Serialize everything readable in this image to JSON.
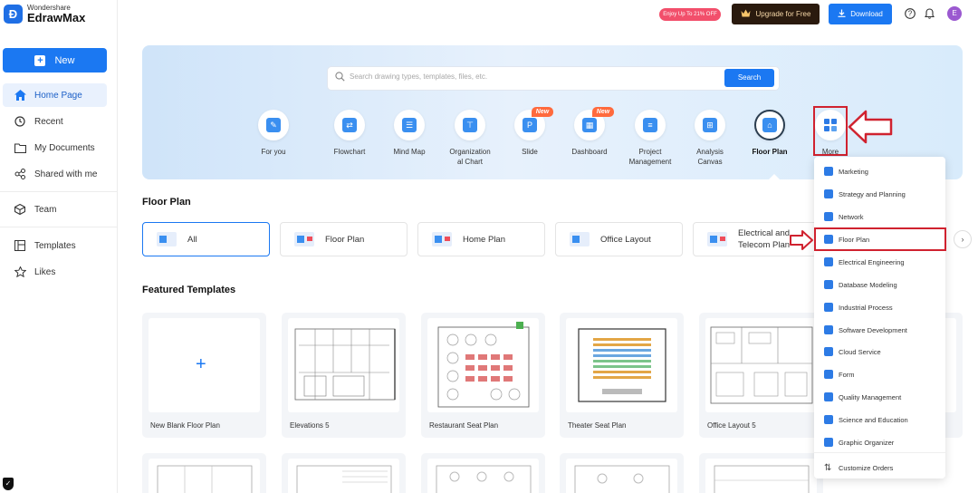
{
  "app": {
    "brand_small": "Wondershare",
    "brand_name": "EdrawMax"
  },
  "sidebar": {
    "new_label": "New",
    "items": [
      {
        "label": "Home Page",
        "icon": "home-icon",
        "active": true
      },
      {
        "label": "Recent",
        "icon": "clock-icon"
      },
      {
        "label": "My Documents",
        "icon": "folder-icon"
      },
      {
        "label": "Shared with me",
        "icon": "share-icon"
      },
      {
        "label": "Team",
        "icon": "team-icon"
      },
      {
        "label": "Templates",
        "icon": "templates-icon"
      },
      {
        "label": "Likes",
        "icon": "star-icon"
      }
    ]
  },
  "topbar": {
    "promo": "Enjoy Up To 21% OFF",
    "upgrade_label": "Upgrade for Free",
    "download_label": "Download",
    "avatar_letter": "E"
  },
  "hero": {
    "search_placeholder": "Search drawing types, templates, files, etc.",
    "search_button": "Search",
    "categories": [
      {
        "label": "For you",
        "icon": "for-you-icon"
      },
      {
        "label": "Flowchart",
        "icon": "flowchart-icon"
      },
      {
        "label": "Mind Map",
        "icon": "mind-map-icon"
      },
      {
        "label": "Organization\nal Chart",
        "icon": "org-chart-icon"
      },
      {
        "label": "Slide",
        "icon": "slide-icon",
        "badge": "New"
      },
      {
        "label": "Dashboard",
        "icon": "dashboard-icon",
        "badge": "New"
      },
      {
        "label": "Project\nManagement",
        "icon": "project-icon"
      },
      {
        "label": "Analysis\nCanvas",
        "icon": "analysis-icon"
      },
      {
        "label": "Floor Plan",
        "icon": "floor-plan-icon",
        "active": true
      },
      {
        "label": "More",
        "icon": "more-icon"
      }
    ]
  },
  "section": {
    "title": "Floor Plan",
    "filters": [
      "All",
      "Floor Plan",
      "Home Plan",
      "Office Layout",
      "Electrical and\nTelecom Plan"
    ]
  },
  "featured": {
    "title": "Featured Templates",
    "cards": [
      "New Blank Floor Plan",
      "Elevations 5",
      "Restaurant Seat Plan",
      "Theater Seat Plan",
      "Office Layout 5"
    ]
  },
  "more_menu": {
    "items": [
      "Marketing",
      "Strategy and Planning",
      "Network",
      "Floor Plan",
      "Electrical Engineering",
      "Database Modeling",
      "Industrial Process",
      "Software Development",
      "Cloud Service",
      "Form",
      "Quality Management",
      "Science and Education",
      "Graphic Organizer"
    ],
    "footer": "Customize Orders"
  },
  "colors": {
    "accent": "#1b78f2",
    "highlight": "#d0222f",
    "hero_bg": "#dbeafb"
  }
}
